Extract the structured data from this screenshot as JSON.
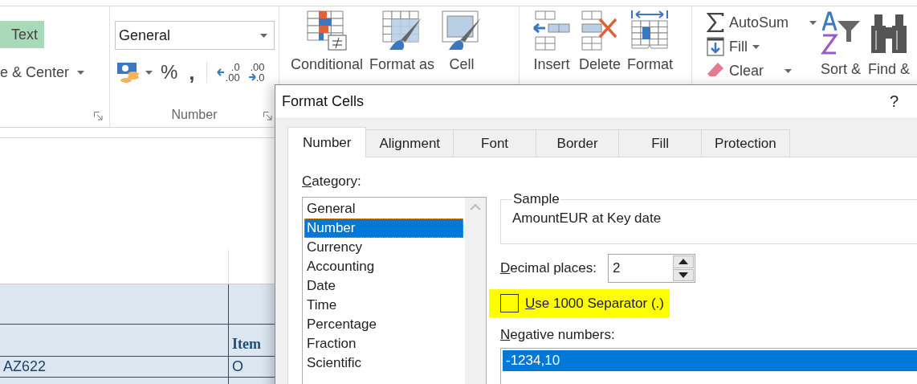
{
  "ribbon": {
    "alignment": {
      "wrap_text": {
        "label": "Text",
        "highlighted": true
      },
      "merge_center": {
        "label": "e & Center"
      }
    },
    "number": {
      "format": {
        "value": "General"
      },
      "percent": "%",
      "comma": ",",
      "decimals": [
        {
          "kind": "increase",
          "top": ".0",
          "bottom": ".00"
        },
        {
          "kind": "decrease",
          "top": ".00",
          "bottom": ".0"
        }
      ],
      "label": "Number"
    },
    "styles": [
      {
        "kind": "conditional",
        "label": "Conditional"
      },
      {
        "kind": "table",
        "label": "Format as"
      },
      {
        "kind": "cell",
        "label": "Cell"
      }
    ],
    "cells": [
      {
        "kind": "insert",
        "label": "Insert"
      },
      {
        "kind": "delete",
        "label": "Delete"
      },
      {
        "kind": "format",
        "label": "Format"
      }
    ],
    "editing": {
      "small": [
        {
          "kind": "sum",
          "label": "AutoSum"
        },
        {
          "kind": "fill",
          "label": "Fill"
        },
        {
          "kind": "clear",
          "label": "Clear"
        }
      ],
      "large": [
        {
          "kind": "sort",
          "label": "Sort &"
        },
        {
          "kind": "find",
          "label": "Find &"
        }
      ]
    }
  },
  "sheet": {
    "rows": [
      {
        "kind": "plain",
        "cells": [
          "",
          ""
        ]
      },
      {
        "kind": "band",
        "cells": [
          "",
          ""
        ]
      },
      {
        "kind": "header",
        "cells": [
          "",
          "Item"
        ]
      },
      {
        "kind": "data",
        "cells": [
          "AZ622",
          "O"
        ]
      },
      {
        "kind": "band",
        "cells": [
          "",
          ""
        ]
      }
    ]
  },
  "dialog": {
    "title": "Format Cells",
    "help": "?",
    "tabs": [
      {
        "label": "Number",
        "selected": true
      },
      {
        "label": "Alignment",
        "selected": false
      },
      {
        "label": "Font",
        "selected": false
      },
      {
        "label": "Border",
        "selected": false
      },
      {
        "label": "Fill",
        "selected": false
      },
      {
        "label": "Protection",
        "selected": false
      }
    ],
    "category": {
      "label": "Category:",
      "items": [
        {
          "label": "General",
          "selected": false
        },
        {
          "label": "Number",
          "selected": true
        },
        {
          "label": "Currency",
          "selected": false
        },
        {
          "label": "Accounting",
          "selected": false
        },
        {
          "label": "Date",
          "selected": false
        },
        {
          "label": "Time",
          "selected": false
        },
        {
          "label": "Percentage",
          "selected": false
        },
        {
          "label": "Fraction",
          "selected": false
        },
        {
          "label": "Scientific",
          "selected": false
        }
      ]
    },
    "sample": {
      "legend": "Sample",
      "value": "AmountEUR at Key date"
    },
    "decimal_places": {
      "label": "Decimal places:",
      "value": "2"
    },
    "separator": {
      "label": "Use 1000 Separator (.)",
      "checked": false,
      "highlighted": true
    },
    "negative_numbers": {
      "label": "Negative numbers:",
      "items": [
        {
          "label": "-1234,10",
          "selected": true
        }
      ]
    }
  }
}
